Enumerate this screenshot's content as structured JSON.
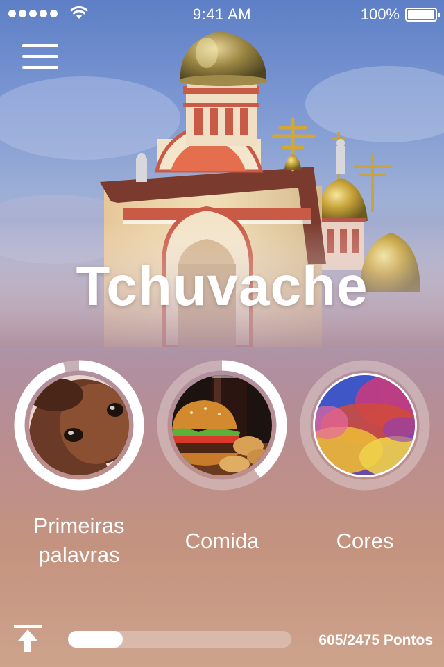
{
  "status_bar": {
    "time": "9:41 AM",
    "battery": "100%",
    "icons": [
      "signal-dots-icon",
      "wifi-icon",
      "battery-icon"
    ]
  },
  "header": {
    "menu_icon": "hamburger-menu-icon",
    "title": "Tchuvache"
  },
  "categories": [
    {
      "label_line1": "Primeiras",
      "label_line2": "palavras",
      "image": "baby-face",
      "progress": 0.96
    },
    {
      "label": "Comida",
      "image": "burger-and-soda",
      "progress": 0.4
    },
    {
      "label": "Cores",
      "image": "colored-powder",
      "progress": 0
    }
  ],
  "footer": {
    "upload_icon": "upload-arrow-icon",
    "points_current": 605,
    "points_total": 2475,
    "points_text": "605/2475 Pontos"
  },
  "colors": {
    "sky_top": "#5e7fc6",
    "bottom": "#cda38c",
    "ring_track": "#d9c4c4",
    "ring_fill": "#ffffff"
  }
}
